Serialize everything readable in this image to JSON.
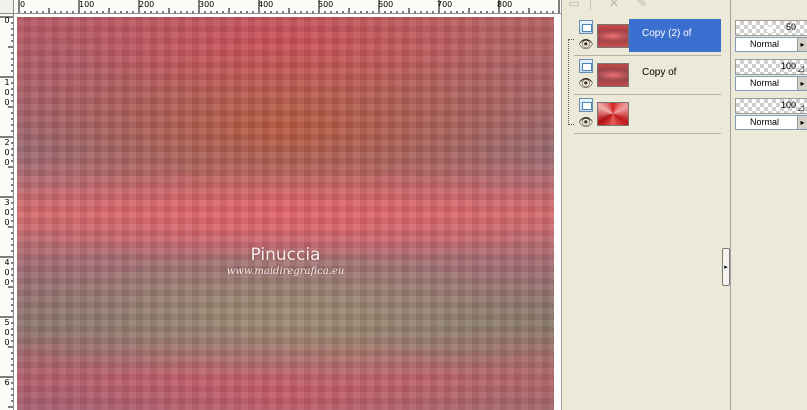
{
  "rulers": {
    "top_labels": [
      "0",
      "100",
      "200",
      "300",
      "400",
      "500",
      "600",
      "700",
      "800"
    ],
    "left_labels": [
      [
        "0"
      ],
      [
        "1",
        "0",
        "0"
      ],
      [
        "2",
        "0",
        "0"
      ],
      [
        "3",
        "0",
        "0"
      ],
      [
        "4",
        "0",
        "0"
      ],
      [
        "5",
        "0",
        "0"
      ],
      [
        "6"
      ]
    ]
  },
  "canvas": {
    "watermark_name": "Pinuccia",
    "watermark_url": "www.maidiregrafica.eu"
  },
  "layers_toolbar": {
    "icons": [
      "new-layer-icon",
      "delete-layer-icon",
      "brush-icon"
    ]
  },
  "layers": [
    {
      "name": "Copy (2) of",
      "selected": true,
      "visible": true,
      "thumbnail": "red-sunburst"
    },
    {
      "name": "Copy of",
      "selected": false,
      "visible": true,
      "thumbnail": "red-sunburst"
    },
    {
      "name": "",
      "selected": false,
      "visible": true,
      "thumbnail": "red-sunburst-bright"
    }
  ],
  "layer_properties": [
    {
      "opacity": "50",
      "blend_mode": "Normal"
    },
    {
      "opacity": "100",
      "blend_mode": "Normal"
    },
    {
      "opacity": "100",
      "blend_mode": "Normal"
    }
  ],
  "colors": {
    "selection": "#3a6fcf",
    "panel_bg": "#ece9d8",
    "ruler_bg": "#fbfbf7"
  }
}
